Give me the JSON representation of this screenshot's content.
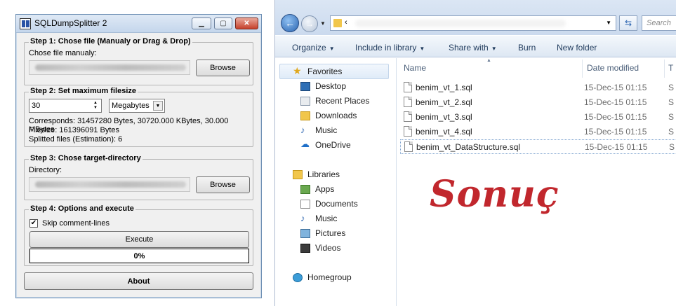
{
  "app": {
    "title": "SQLDumpSplitter 2",
    "step1": {
      "title": "Step 1: Chose file (Manualy or Drag & Drop)",
      "label": "Chose file manualy:",
      "browse": "Browse"
    },
    "step2": {
      "title": "Step 2: Set maximum filesize",
      "size_value": "30",
      "unit": "Megabytes",
      "corresponds": "Corresponds: 31457280 Bytes, 30720.000 KBytes, 30.000 MBytes",
      "filesize": "Filesize: 161396091 Bytes",
      "splitted": "Splitted files (Estimation): 6"
    },
    "step3": {
      "title": "Step 3: Chose target-directory",
      "label": "Directory:",
      "browse": "Browse"
    },
    "step4": {
      "title": "Step 4: Options and execute",
      "skip_comments": "Skip comment-lines",
      "skip_checked": true,
      "execute": "Execute",
      "progress": "0%",
      "progress_value": 0
    },
    "about": "About"
  },
  "explorer": {
    "address_chevron": "‹",
    "search_placeholder": "Search",
    "toolbar": {
      "organize": "Organize",
      "include": "Include in library",
      "share": "Share with",
      "burn": "Burn",
      "new_folder": "New folder"
    },
    "nav": {
      "favorites": "Favorites",
      "fav_items": [
        "Desktop",
        "Recent Places",
        "Downloads",
        "Music",
        "OneDrive"
      ],
      "libraries": "Libraries",
      "lib_items": [
        "Apps",
        "Documents",
        "Music",
        "Pictures",
        "Videos"
      ],
      "homegroup": "Homegroup"
    },
    "columns": {
      "name": "Name",
      "date": "Date modified",
      "type": "T"
    },
    "files": [
      {
        "name": "benim_vt_1.sql",
        "date": "15-Dec-15 01:15",
        "type": "S"
      },
      {
        "name": "benim_vt_2.sql",
        "date": "15-Dec-15 01:15",
        "type": "S"
      },
      {
        "name": "benim_vt_3.sql",
        "date": "15-Dec-15 01:15",
        "type": "S"
      },
      {
        "name": "benim_vt_4.sql",
        "date": "15-Dec-15 01:15",
        "type": "S"
      },
      {
        "name": "benim_vt_DataStructure.sql",
        "date": "15-Dec-15 01:15",
        "type": "S"
      }
    ]
  },
  "overlay": {
    "text": "Sonuç",
    "color": "#c1272d"
  }
}
